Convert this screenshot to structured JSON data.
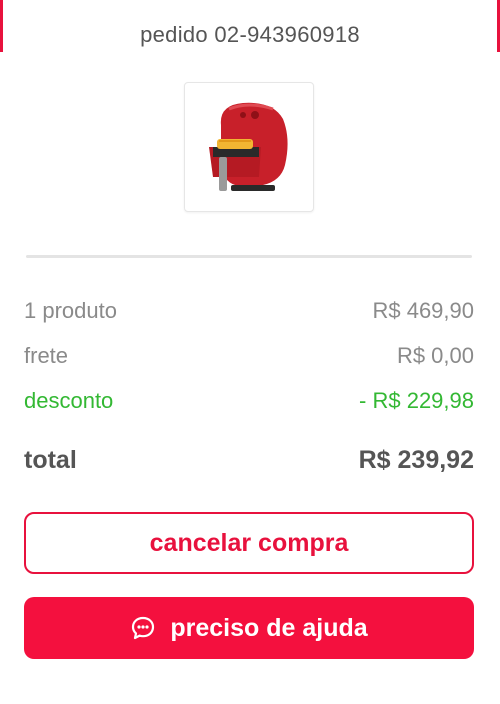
{
  "order": {
    "label": "pedido 02-943960918"
  },
  "product": {
    "image_icon": "air-fryer-image",
    "color": "#c8202a"
  },
  "summary": {
    "items_label": "1 produto",
    "items_value": "R$ 469,90",
    "shipping_label": "frete",
    "shipping_value": "R$ 0,00",
    "discount_label": "desconto",
    "discount_value": "- R$ 229,98",
    "total_label": "total",
    "total_value": "R$ 239,92"
  },
  "actions": {
    "cancel_label": "cancelar compra",
    "help_label": "preciso de ajuda",
    "help_icon": "chat-bubble-icon"
  },
  "colors": {
    "accent": "#e8113d",
    "discount": "#33b833",
    "muted_text": "#8a8a8a",
    "strong_text": "#555555"
  }
}
